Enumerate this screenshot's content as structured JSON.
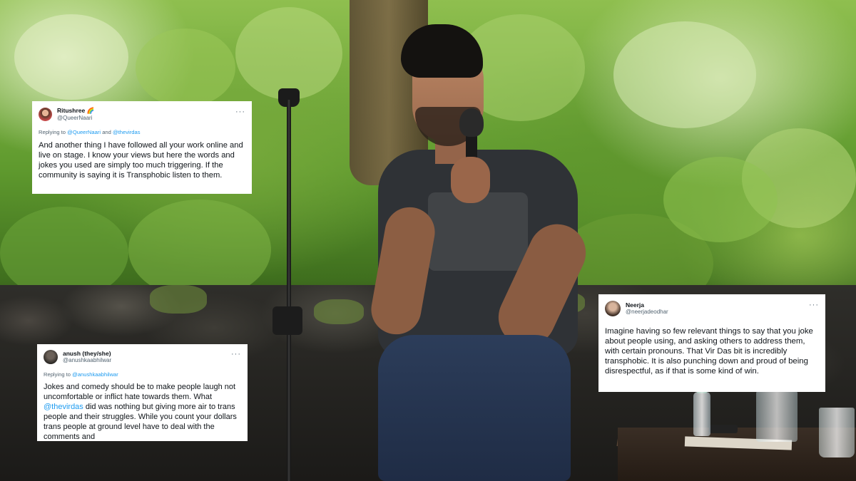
{
  "tweets": [
    {
      "display_name": "Ritushree 🌈",
      "handle": "@QueerNaari",
      "more": "···",
      "reply_prefix": "Replying to ",
      "reply_user_1": "@QueerNaari",
      "reply_and": " and ",
      "reply_user_2": "@thevirdas",
      "body": "And another thing I have followed all your work online and live on stage. I know your views but here the words and jokes you used are simply too much triggering. If the community is saying it is Transphobic listen to them."
    },
    {
      "display_name": "anush (they/she)",
      "handle": "@anushkaabhilwar",
      "more": "···",
      "reply_prefix": "Replying to ",
      "reply_user_1": "@anushkaabhilwar",
      "body_part_1": "Jokes and comedy should be to make people laugh not uncomfortable or inflict hate towards them. What ",
      "body_mention": "@thevirdas",
      "body_part_2": " did was nothing but giving more air to trans people and their struggles. While you count your dollars trans people at ground level have to deal with the comments and"
    },
    {
      "display_name": "Neerja",
      "handle": "@neerjadeodhar",
      "more": "···",
      "body": "Imagine having so few relevant things to say that you joke about people using, and asking others to address them, with certain pronouns. That Vir Das bit is incredibly transphobic. It is also punching down and proud of being disrespectful, as if that is some kind of win."
    }
  ],
  "colors": {
    "link": "#1d9bf0",
    "text": "#0f1419",
    "secondary": "#536471",
    "card_bg": "#ffffff"
  }
}
